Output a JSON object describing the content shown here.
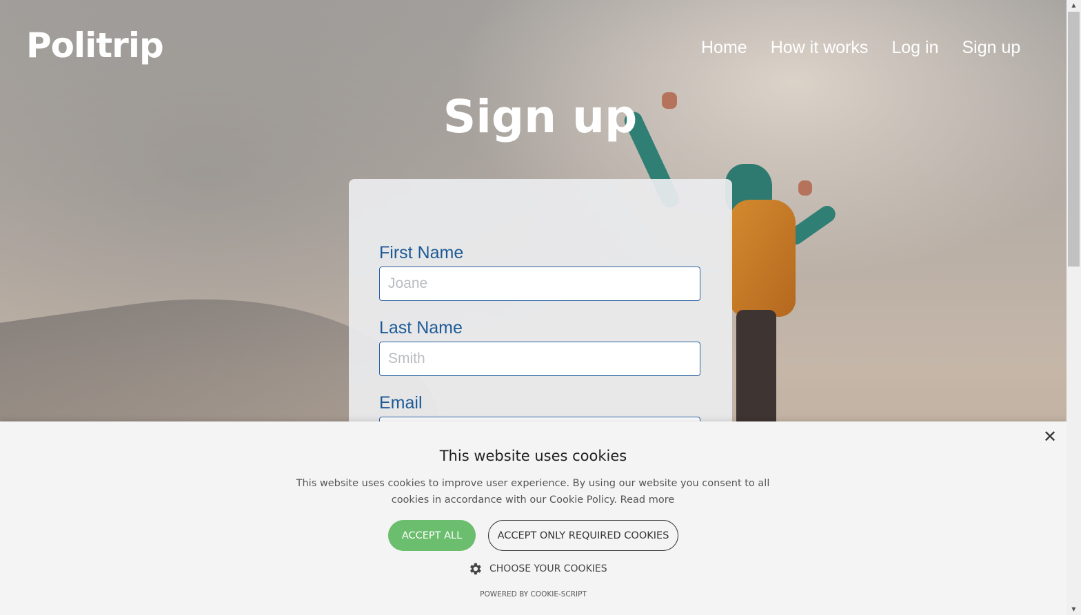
{
  "header": {
    "logo": "Politrip",
    "nav": [
      "Home",
      "How it works",
      "Log in",
      "Sign up"
    ]
  },
  "page": {
    "title": "Sign up"
  },
  "form": {
    "first_name": {
      "label": "First Name",
      "placeholder": "Joane"
    },
    "last_name": {
      "label": "Last Name",
      "placeholder": "Smith"
    },
    "email": {
      "label": "Email",
      "placeholder": ""
    }
  },
  "cookie_banner": {
    "title": "This website uses cookies",
    "text": "This website uses cookies to improve user experience. By using our website you consent to all cookies in accordance with our Cookie Policy.",
    "read_more": "Read more",
    "accept_all": "ACCEPT ALL",
    "accept_required": "ACCEPT ONLY REQUIRED COOKIES",
    "choose": "CHOOSE YOUR COOKIES",
    "powered_by": "POWERED BY COOKIE-SCRIPT",
    "close_icon": "close-icon",
    "gear_icon": "gear-icon"
  },
  "colors": {
    "accent_blue": "#1d5a96",
    "accept_green": "#6cbe6f"
  }
}
